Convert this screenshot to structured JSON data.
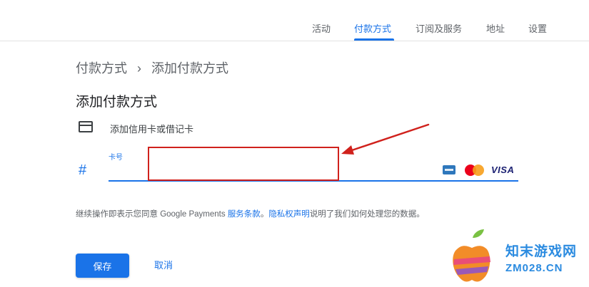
{
  "nav": {
    "tabs": [
      {
        "label": "活动",
        "active": false
      },
      {
        "label": "付款方式",
        "active": true
      },
      {
        "label": "订阅及服务",
        "active": false
      },
      {
        "label": "地址",
        "active": false
      },
      {
        "label": "设置",
        "active": false
      }
    ]
  },
  "breadcrumb": {
    "parent": "付款方式",
    "separator": "›",
    "current": "添加付款方式"
  },
  "page": {
    "title": "添加付款方式"
  },
  "option": {
    "icon": "credit-card-icon",
    "label": "添加信用卡或借记卡"
  },
  "card_field": {
    "label": "卡号",
    "value": "",
    "icon": "hash-icon",
    "brand_visa": "VISA",
    "highlight_color": "#d0211c"
  },
  "terms": {
    "prefix": "继续操作即表示您同意 Google Payments ",
    "terms_link": "服务条款",
    "middle": "。",
    "privacy_link": "隐私权声明",
    "suffix": "说明了我们如何处理您的数据。"
  },
  "actions": {
    "save_label": "保存",
    "cancel_label": "取消"
  },
  "watermark": {
    "title": "知末游戏网",
    "url": "ZM028.CN"
  },
  "colors": {
    "accent": "#1a73e8",
    "annotation": "#d0211c"
  }
}
